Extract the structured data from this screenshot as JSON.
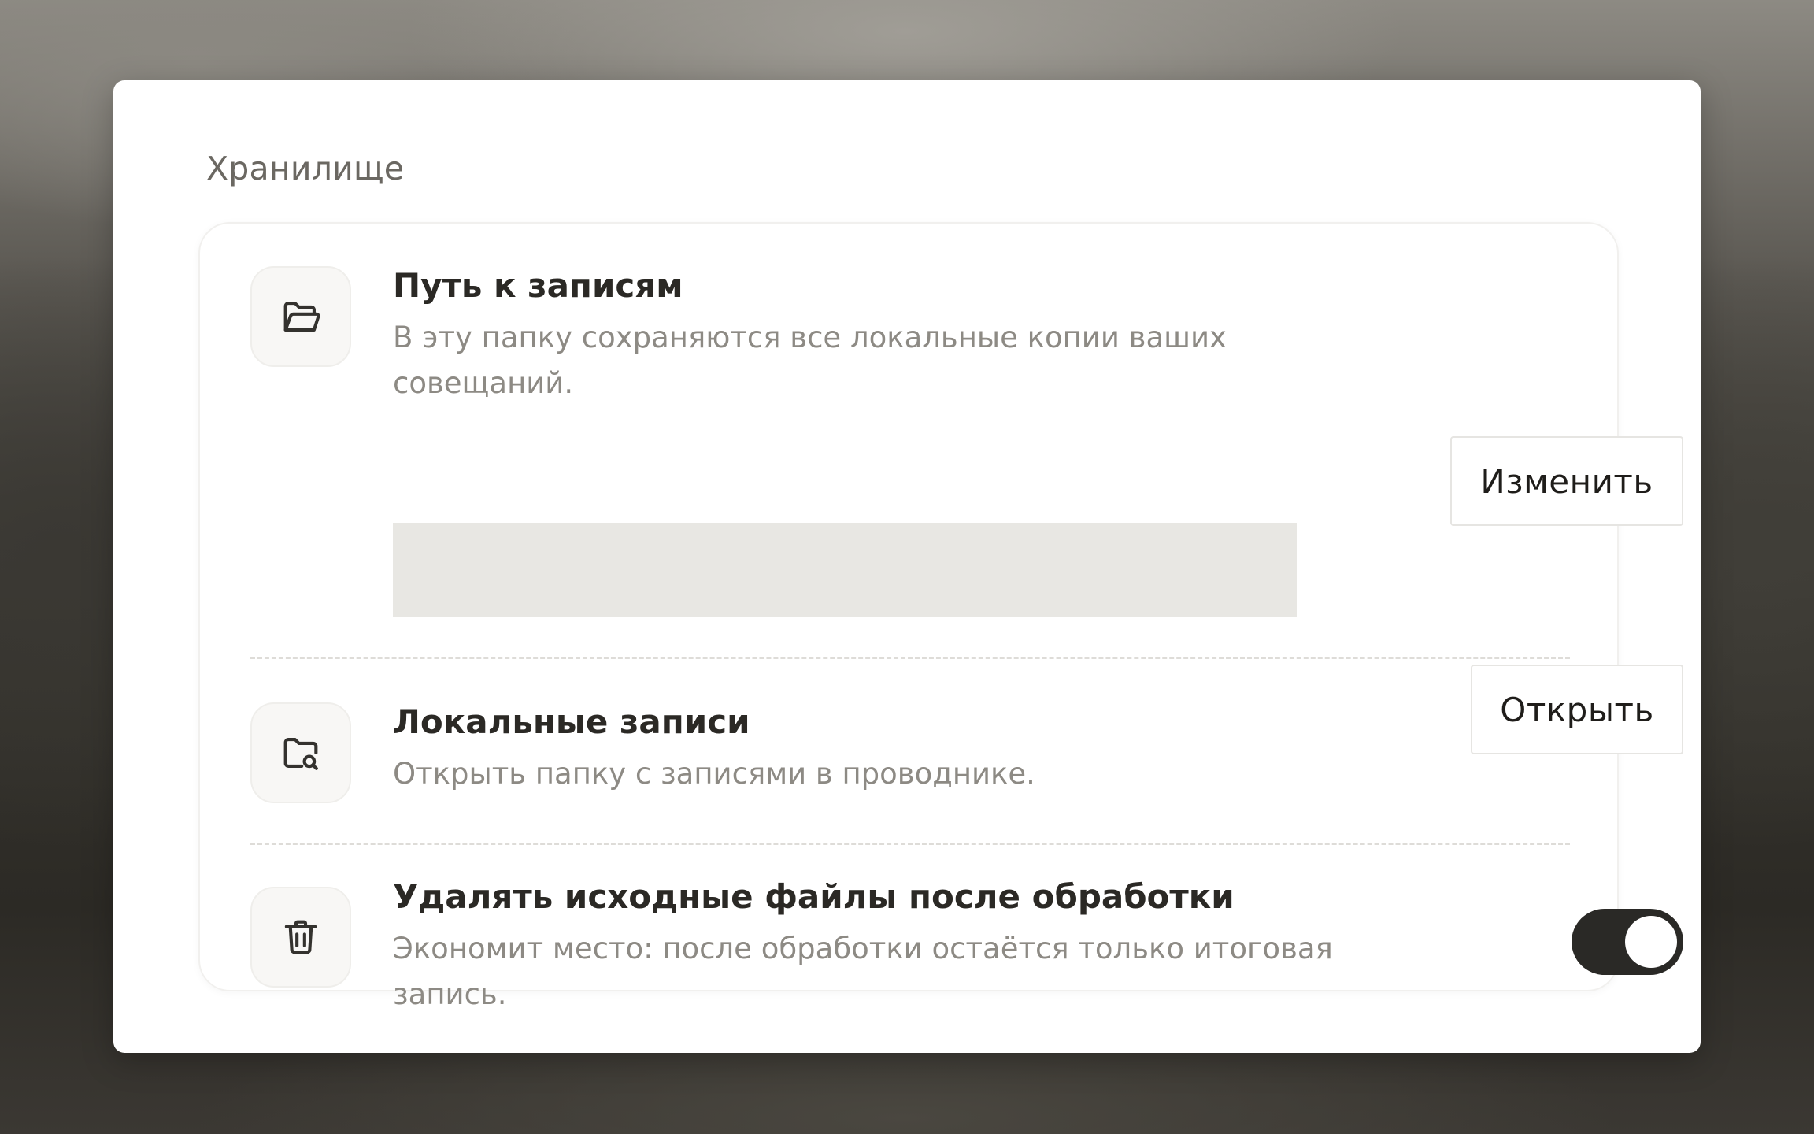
{
  "section": {
    "title": "Хранилище"
  },
  "rows": [
    {
      "icon": "folder-open-icon",
      "title": "Путь к записям",
      "description_line1": "В эту папку сохраняются все локальные копии ваших",
      "description_line2": "совещаний.",
      "path_value": "",
      "button_label": "Изменить"
    },
    {
      "icon": "folder-search-icon",
      "title": "Локальные записи",
      "description": "Открыть папку с записями в проводнике.",
      "button_label": "Открыть"
    },
    {
      "icon": "trash-icon",
      "title": "Удалять исходные файлы после обработки",
      "description_line1": "Экономит место: после обработки остаётся только итоговая",
      "description_line2": "запись.",
      "toggle_on": true
    }
  ],
  "colors": {
    "toggle_on": "#2a2926",
    "path_placeholder": "#e8e7e3",
    "title_text": "#2b2925",
    "description_text": "#8d8a84"
  }
}
